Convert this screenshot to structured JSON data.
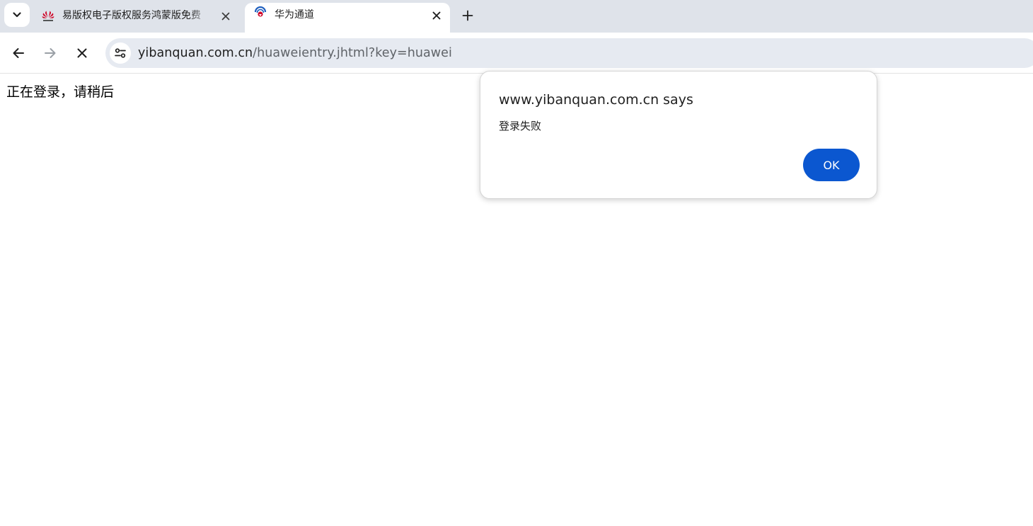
{
  "tabs": [
    {
      "title": "易版权电子版权服务鸿蒙版免费",
      "favicon": "huawei-logo-icon",
      "active": false
    },
    {
      "title": "华为通道",
      "favicon": "site-favicon-icon",
      "active": true
    }
  ],
  "address_bar": {
    "host": "yibanquan.com.cn",
    "path": "/huaweientry.jhtml?key=huawei"
  },
  "page": {
    "loading_text": "正在登录，请稍后"
  },
  "alert": {
    "title": "www.yibanquan.com.cn says",
    "message": "登录失败",
    "ok_label": "OK"
  },
  "colors": {
    "accent": "#0b57d0",
    "tabstrip_bg": "#dfe3ea",
    "omnibox_bg": "#e6eaf1",
    "huawei_red": "#cf0a2c"
  }
}
